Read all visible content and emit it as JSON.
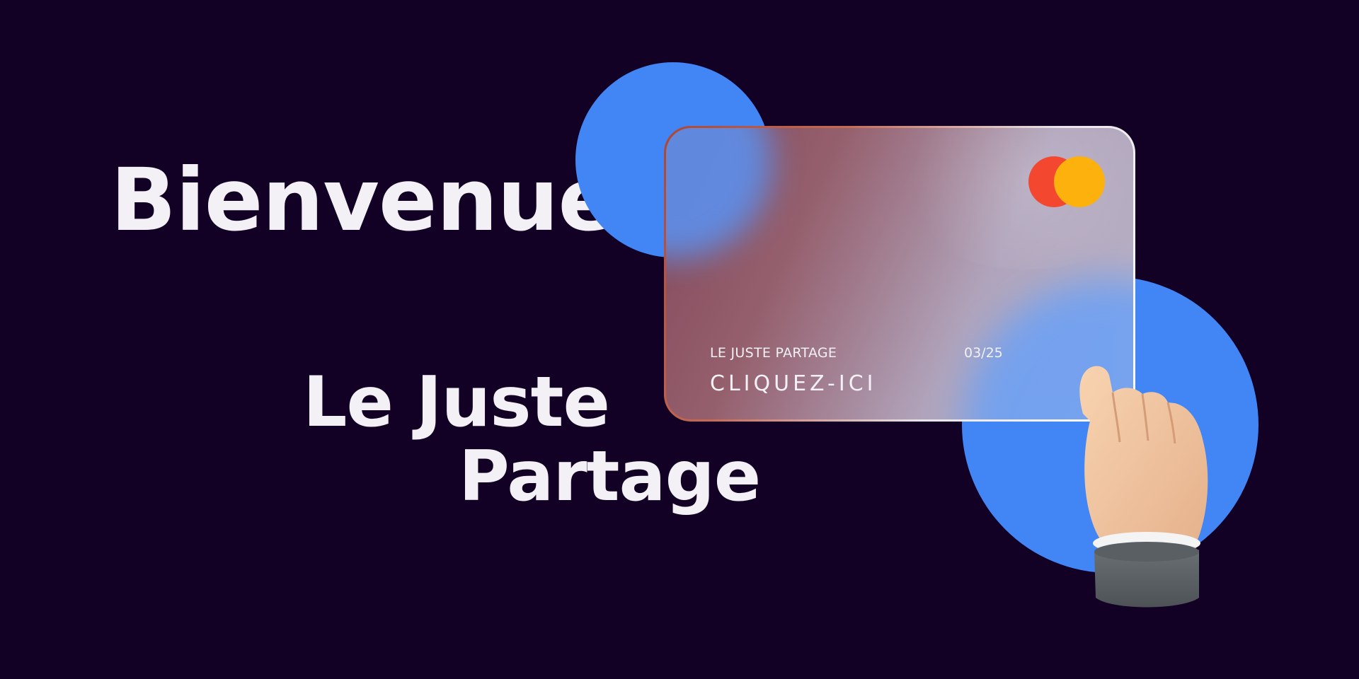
{
  "hero": {
    "greeting": "Bienvenue",
    "brand_line_1": "Le Juste",
    "brand_line_2": "Partage"
  },
  "card": {
    "holder": "LE JUSTE PARTAGE",
    "expiry": "03/25",
    "cta": "CLIQUEZ-ICI",
    "logo_icon": "card-network-logo-icon"
  },
  "illustration": {
    "hand_icon": "pointing-hand-icon"
  },
  "colors": {
    "background": "#120025",
    "accent_blue": "#4285f4",
    "logo_red": "#f4472f",
    "logo_yellow": "#fdb10d",
    "text": "#f3f1f6"
  }
}
